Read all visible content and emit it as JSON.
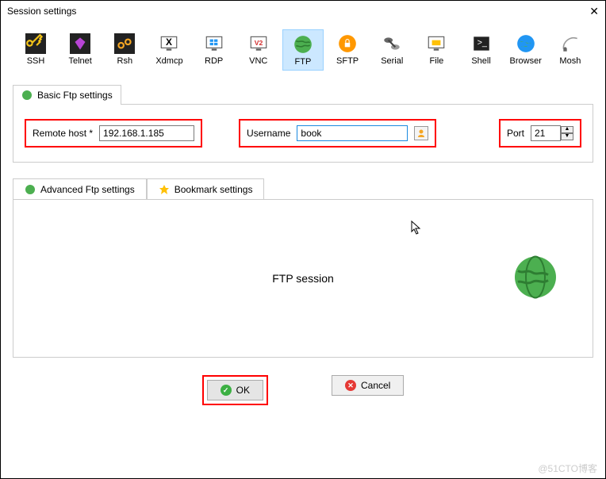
{
  "window": {
    "title": "Session settings"
  },
  "protocols": [
    {
      "id": "ssh",
      "label": "SSH"
    },
    {
      "id": "telnet",
      "label": "Telnet"
    },
    {
      "id": "rsh",
      "label": "Rsh"
    },
    {
      "id": "xdmcp",
      "label": "Xdmcp"
    },
    {
      "id": "rdp",
      "label": "RDP"
    },
    {
      "id": "vnc",
      "label": "VNC"
    },
    {
      "id": "ftp",
      "label": "FTP",
      "selected": true
    },
    {
      "id": "sftp",
      "label": "SFTP"
    },
    {
      "id": "serial",
      "label": "Serial"
    },
    {
      "id": "file",
      "label": "File"
    },
    {
      "id": "shell",
      "label": "Shell"
    },
    {
      "id": "browser",
      "label": "Browser"
    },
    {
      "id": "mosh",
      "label": "Mosh"
    }
  ],
  "basic": {
    "tab_label": "Basic Ftp settings",
    "remote_host_label": "Remote host *",
    "remote_host_value": "192.168.1.185",
    "username_label": "Username",
    "username_value": "book",
    "port_label": "Port",
    "port_value": "21"
  },
  "secondary_tabs": {
    "advanced": "Advanced Ftp settings",
    "bookmark": "Bookmark settings"
  },
  "content": {
    "title": "FTP session"
  },
  "buttons": {
    "ok": "OK",
    "cancel": "Cancel"
  },
  "watermark": "@51CTO博客"
}
